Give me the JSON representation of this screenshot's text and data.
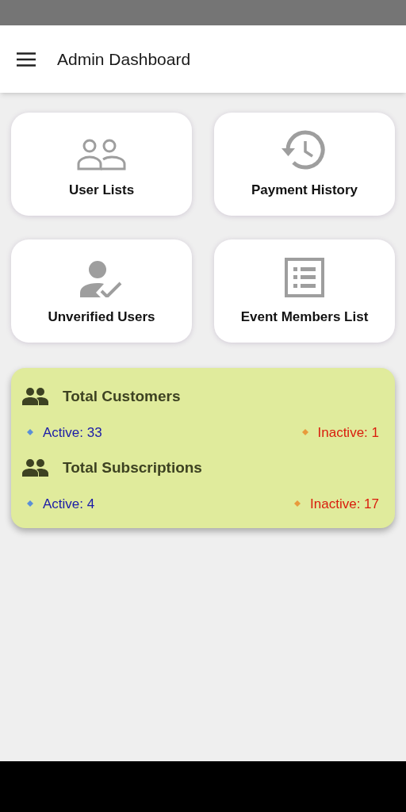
{
  "app_bar": {
    "title": "Admin Dashboard"
  },
  "tiles": [
    {
      "label": "User Lists",
      "kind": "people"
    },
    {
      "label": "Payment History",
      "kind": "history"
    },
    {
      "label": "Unverified Users",
      "kind": "person-check"
    },
    {
      "label": "Event Members List",
      "kind": "list"
    }
  ],
  "stats": [
    {
      "title": "Total Customers",
      "active": "Active: 33",
      "inactive": "Inactive: 1"
    },
    {
      "title": "Total Subscriptions",
      "active": "Active: 4",
      "inactive": "Inactive: 17"
    }
  ]
}
